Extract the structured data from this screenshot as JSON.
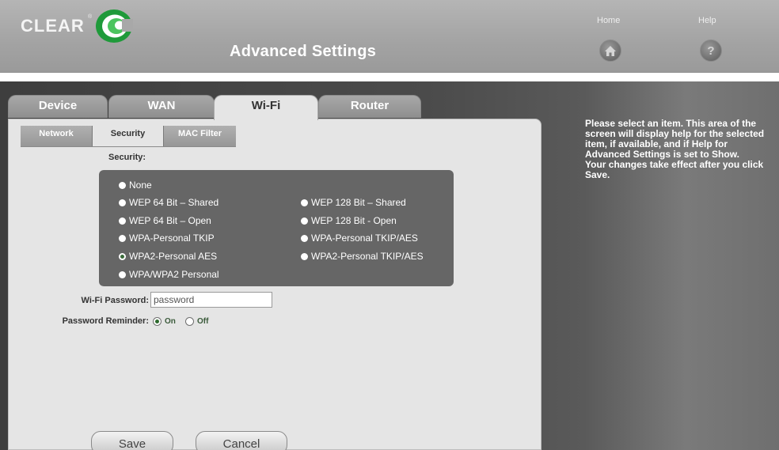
{
  "header": {
    "brand": "CLEAR",
    "brand_tm": "®",
    "title": "Advanced Settings",
    "nav": [
      {
        "label": "Home",
        "icon": "home-icon"
      },
      {
        "label": "Help",
        "icon": "question-icon"
      }
    ]
  },
  "tabs": [
    {
      "label": "Device",
      "active": false
    },
    {
      "label": "WAN",
      "active": false
    },
    {
      "label": "Wi-Fi",
      "active": true
    },
    {
      "label": "Router",
      "active": false
    }
  ],
  "subtabs": [
    {
      "label": "Network",
      "active": false
    },
    {
      "label": "Security",
      "active": true
    },
    {
      "label": "MAC Filter",
      "active": false
    }
  ],
  "security": {
    "label": "Security:",
    "options": [
      {
        "label": "None",
        "selected": false
      },
      {
        "label": "WEP 64 Bit – Shared",
        "selected": false
      },
      {
        "label": "WEP 128 Bit – Shared",
        "selected": false
      },
      {
        "label": "WEP 64 Bit – Open",
        "selected": false
      },
      {
        "label": "WEP 128 Bit - Open",
        "selected": false
      },
      {
        "label": "WPA-Personal TKIP",
        "selected": false
      },
      {
        "label": "WPA-Personal TKIP/AES",
        "selected": false
      },
      {
        "label": "WPA2-Personal AES",
        "selected": true
      },
      {
        "label": "WPA2-Personal TKIP/AES",
        "selected": false
      },
      {
        "label": "WPA/WPA2 Personal",
        "selected": false
      }
    ]
  },
  "form": {
    "password_label": "Wi-Fi Password:",
    "password_value": "password",
    "reminder_label": "Password Reminder:",
    "reminder_on": "On",
    "reminder_off": "Off",
    "reminder_selected": "On"
  },
  "buttons": {
    "save": "Save",
    "cancel": "Cancel"
  },
  "help": {
    "text": "Please select an item. This area of the screen will display help for the selected item, if available, and if Help for Advanced Settings is set to Show.",
    "note": "Your changes take effect after you click Save."
  },
  "colors": {
    "header_bg": "#a3a3a3",
    "panel_bg": "#e5e5e5",
    "options_bg": "#666666",
    "main_bg": "#4b4b4b"
  }
}
